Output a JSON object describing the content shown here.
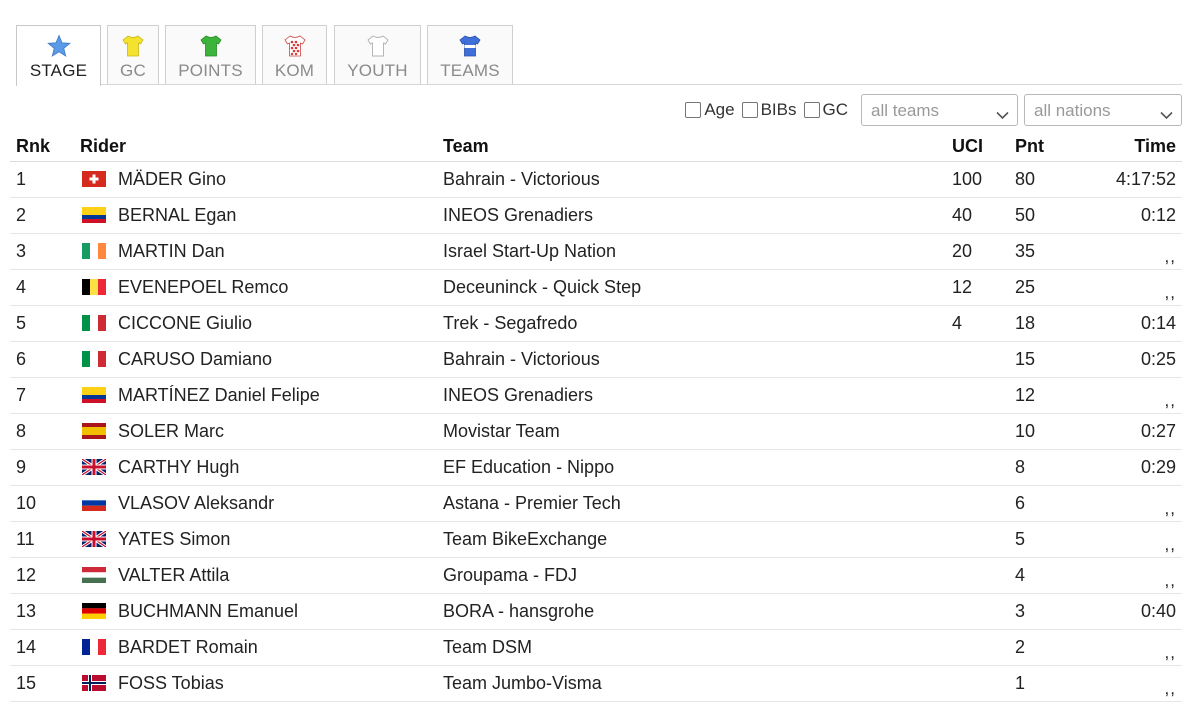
{
  "tabs": [
    {
      "label": "STAGE",
      "icon": "star-icon",
      "color": "#4a90e2",
      "active": true
    },
    {
      "label": "GC",
      "icon": "yellow-jersey-icon",
      "color": "#f2e233"
    },
    {
      "label": "POINTS",
      "icon": "green-jersey-icon",
      "color": "#33b233"
    },
    {
      "label": "KOM",
      "icon": "polka-dot-jersey-icon",
      "color": "#d83a3a"
    },
    {
      "label": "YOUTH",
      "icon": "white-jersey-icon",
      "color": "#ffffff"
    },
    {
      "label": "TEAMS",
      "icon": "teams-jersey-icon",
      "color": "#3f6fd8"
    }
  ],
  "filters": {
    "checkboxes": [
      {
        "label": "Age",
        "checked": false
      },
      {
        "label": "BIBs",
        "checked": false
      },
      {
        "label": "GC",
        "checked": false
      }
    ],
    "team_select": "all teams",
    "nation_select": "all nations"
  },
  "table": {
    "headers": {
      "rnk": "Rnk",
      "rider": "Rider",
      "team": "Team",
      "uci": "UCI",
      "pnt": "Pnt",
      "time": "Time"
    },
    "rows": [
      {
        "rnk": "1",
        "flag": "ch",
        "rider": "MÄDER Gino",
        "team": "Bahrain - Victorious",
        "uci": "100",
        "pnt": "80",
        "time": "4:17:52"
      },
      {
        "rnk": "2",
        "flag": "co",
        "rider": "BERNAL Egan",
        "team": "INEOS Grenadiers",
        "uci": "40",
        "pnt": "50",
        "time": "0:12"
      },
      {
        "rnk": "3",
        "flag": "ie",
        "rider": "MARTIN Dan",
        "team": "Israel Start-Up Nation",
        "uci": "20",
        "pnt": "35",
        "time": ",,"
      },
      {
        "rnk": "4",
        "flag": "be",
        "rider": "EVENEPOEL Remco",
        "team": "Deceuninck - Quick Step",
        "uci": "12",
        "pnt": "25",
        "time": ",,"
      },
      {
        "rnk": "5",
        "flag": "it",
        "rider": "CICCONE Giulio",
        "team": "Trek - Segafredo",
        "uci": "4",
        "pnt": "18",
        "time": "0:14"
      },
      {
        "rnk": "6",
        "flag": "it",
        "rider": "CARUSO Damiano",
        "team": "Bahrain - Victorious",
        "uci": "",
        "pnt": "15",
        "time": "0:25"
      },
      {
        "rnk": "7",
        "flag": "co",
        "rider": "MARTÍNEZ Daniel Felipe",
        "team": "INEOS Grenadiers",
        "uci": "",
        "pnt": "12",
        "time": ",,"
      },
      {
        "rnk": "8",
        "flag": "es",
        "rider": "SOLER Marc",
        "team": "Movistar Team",
        "uci": "",
        "pnt": "10",
        "time": "0:27"
      },
      {
        "rnk": "9",
        "flag": "gb",
        "rider": "CARTHY Hugh",
        "team": "EF Education - Nippo",
        "uci": "",
        "pnt": "8",
        "time": "0:29"
      },
      {
        "rnk": "10",
        "flag": "ru",
        "rider": "VLASOV Aleksandr",
        "team": "Astana - Premier Tech",
        "uci": "",
        "pnt": "6",
        "time": ",,"
      },
      {
        "rnk": "11",
        "flag": "gb",
        "rider": "YATES Simon",
        "team": "Team BikeExchange",
        "uci": "",
        "pnt": "5",
        "time": ",,"
      },
      {
        "rnk": "12",
        "flag": "hu",
        "rider": "VALTER Attila",
        "team": "Groupama - FDJ",
        "uci": "",
        "pnt": "4",
        "time": ",,"
      },
      {
        "rnk": "13",
        "flag": "de",
        "rider": "BUCHMANN Emanuel",
        "team": "BORA - hansgrohe",
        "uci": "",
        "pnt": "3",
        "time": "0:40"
      },
      {
        "rnk": "14",
        "flag": "fr",
        "rider": "BARDET Romain",
        "team": "Team DSM",
        "uci": "",
        "pnt": "2",
        "time": ",,"
      },
      {
        "rnk": "15",
        "flag": "no",
        "rider": "FOSS Tobias",
        "team": "Team Jumbo-Visma",
        "uci": "",
        "pnt": "1",
        "time": ",,"
      }
    ]
  }
}
